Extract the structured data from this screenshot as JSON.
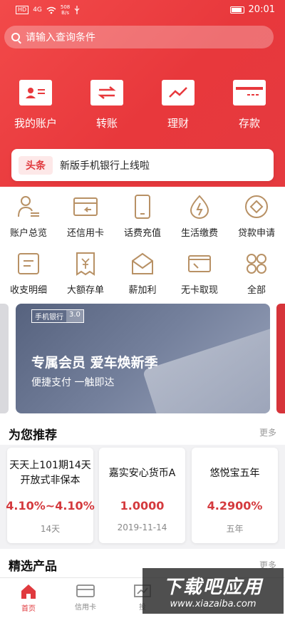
{
  "status_bar": {
    "hd": "HD",
    "signal": "4G",
    "speed_value": "508",
    "speed_unit": "B/s",
    "time": "20:01"
  },
  "search": {
    "placeholder": "请输入查询条件"
  },
  "quick_actions": [
    {
      "label": "我的账户",
      "icon": "account-card-icon"
    },
    {
      "label": "转账",
      "icon": "transfer-icon"
    },
    {
      "label": "理财",
      "icon": "trend-chart-icon"
    },
    {
      "label": "存款",
      "icon": "deposit-card-icon"
    }
  ],
  "news": {
    "tag": "头条",
    "text": "新版手机银行上线啦"
  },
  "services": [
    {
      "label": "账户总览",
      "icon": "account-overview-icon"
    },
    {
      "label": "还信用卡",
      "icon": "credit-card-repay-icon"
    },
    {
      "label": "话费充值",
      "icon": "phone-recharge-icon"
    },
    {
      "label": "生活缴费",
      "icon": "utility-payment-icon"
    },
    {
      "label": "贷款申请",
      "icon": "loan-apply-icon"
    },
    {
      "label": "收支明细",
      "icon": "statement-icon"
    },
    {
      "label": "大额存单",
      "icon": "large-deposit-icon"
    },
    {
      "label": "薪加利",
      "icon": "salary-plus-icon"
    },
    {
      "label": "无卡取现",
      "icon": "cardless-withdraw-icon"
    },
    {
      "label": "全部",
      "icon": "all-services-icon"
    }
  ],
  "banner": {
    "tag_left": "手机银行",
    "tag_right": "3.0",
    "title": "专属会员 爱车焕新季",
    "subtitle": "便捷支付 一触即达"
  },
  "recommend": {
    "title": "为您推荐",
    "more": "更多",
    "products": [
      {
        "name": "天天上101期14天开放式非保本",
        "rate": "4.10%~4.10%",
        "meta": "14天"
      },
      {
        "name": "嘉实安心货币A",
        "rate": "1.0000",
        "meta": "2019-11-14"
      },
      {
        "name": "悠悦宝五年",
        "rate": "4.2900%",
        "meta": "五年"
      }
    ]
  },
  "selected": {
    "title": "精选产品",
    "more": "更多"
  },
  "tabbar": [
    {
      "label": "首页",
      "icon": "home-icon",
      "active": true
    },
    {
      "label": "信用卡",
      "icon": "credit-card-icon",
      "active": false
    },
    {
      "label": "投",
      "icon": "invest-icon",
      "active": false
    }
  ],
  "watermark": {
    "big": "下载吧应用",
    "small": "www.xiazaiba.com"
  },
  "colors": {
    "brand_red": "#e8383c",
    "rate_red": "#d43a3e",
    "icon_gold": "#b89165"
  }
}
